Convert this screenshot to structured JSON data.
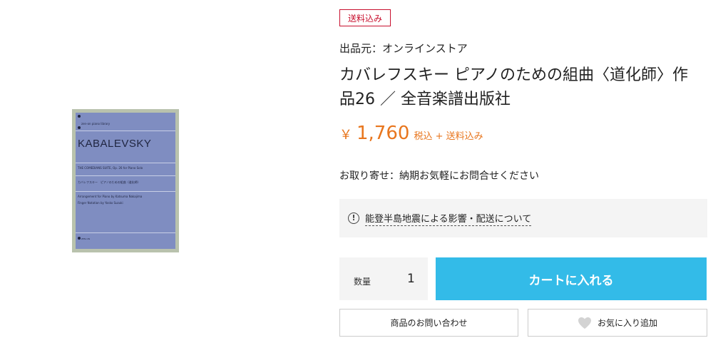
{
  "cover": {
    "series": "zen-on piano library",
    "composer": "KABALEVSKY",
    "line1": "THE COMEDIANS SUITE, Op. 26 for Piano Solo",
    "line2": "カバレフスキー　ピアノのための組曲〈道化師〉",
    "line3": "Arrangement for Piano by Katsuma Nakajima",
    "line4": "Finger Notation by Yasko Suzuki",
    "publisher": "ZEN-ON"
  },
  "badge": "送料込み",
  "seller": "出品元：オンラインストア",
  "title": "カバレフスキー ピアノのための組曲〈道化師〉作品26 ／ 全音楽譜出版社",
  "price": {
    "currency": "￥",
    "value": "1,760",
    "tax_note": "税込 + 送料込み",
    "color": "#e8761e"
  },
  "stock": "お取り寄せ：納期お気軽にお問合せください",
  "notice": {
    "icon": "exclamation-circle-icon",
    "text": "能登半島地震による影響・配送について"
  },
  "quantity": {
    "label": "数量",
    "value": "1"
  },
  "cart_button": {
    "label": "カートに入れる",
    "color": "#33bbe8"
  },
  "inquiry_button": "商品のお問い合わせ",
  "favorite_button": {
    "label": "お気に入り追加",
    "icon": "heart-icon"
  },
  "badge_color": "#c8102e"
}
